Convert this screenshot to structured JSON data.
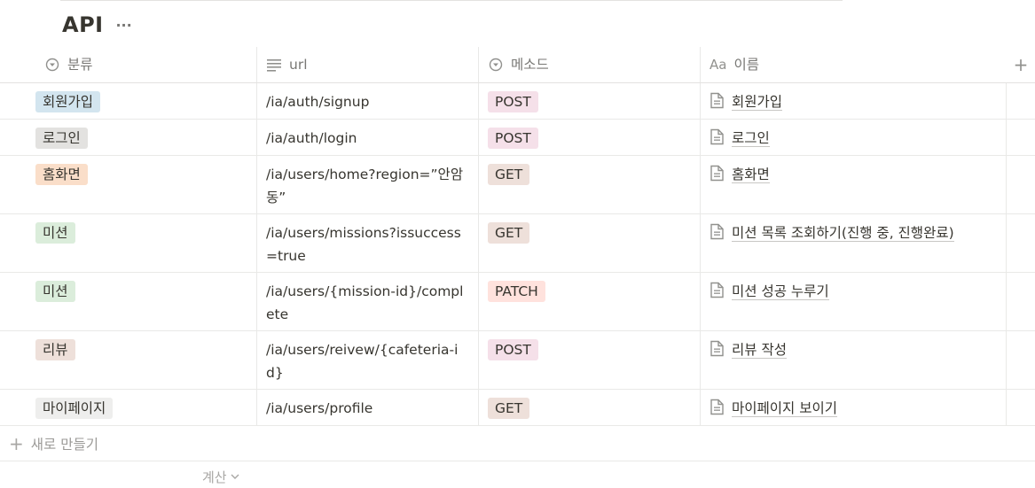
{
  "database": {
    "title": "API",
    "more_icon": "more-horizontal-icon"
  },
  "columns": [
    {
      "label": "분류",
      "icon": "select-icon"
    },
    {
      "label": "url",
      "icon": "text-icon"
    },
    {
      "label": "메소드",
      "icon": "select-icon"
    },
    {
      "label": "이름",
      "icon": "title-icon",
      "icon_text": "Aa"
    }
  ],
  "add_column_icon": "plus-icon",
  "rows": [
    {
      "category": "회원가입",
      "category_color": "blue",
      "url": "/ia/auth/signup",
      "method": "POST",
      "method_color": "pink",
      "name": "회원가입"
    },
    {
      "category": "로그인",
      "category_color": "gray",
      "url": "/ia/auth/login",
      "method": "POST",
      "method_color": "pink",
      "name": "로그인"
    },
    {
      "category": "홈화면",
      "category_color": "orange",
      "url": "/ia/users/home?region=”안암동”",
      "method": "GET",
      "method_color": "brown",
      "name": "홈화면"
    },
    {
      "category": "미션",
      "category_color": "green",
      "url": "/ia/users/missions?issuccess=true",
      "method": "GET",
      "method_color": "brown",
      "name": "미션 목록 조회하기(진행 중, 진행완료)"
    },
    {
      "category": "미션",
      "category_color": "green",
      "url": "/ia/users/{mission-id}/complete",
      "method": "PATCH",
      "method_color": "red",
      "name": "미션 성공 누루기"
    },
    {
      "category": "리뷰",
      "category_color": "brown",
      "url": "/ia/users/reivew/{cafeteria-id}",
      "method": "POST",
      "method_color": "pink",
      "name": "리뷰 작성"
    },
    {
      "category": "마이페이지",
      "category_color": "lightgray",
      "url": "/ia/users/profile",
      "method": "GET",
      "method_color": "brown",
      "name": "마이페이지 보이기"
    }
  ],
  "new_row_label": "새로 만들기",
  "calculate_label": "계산"
}
